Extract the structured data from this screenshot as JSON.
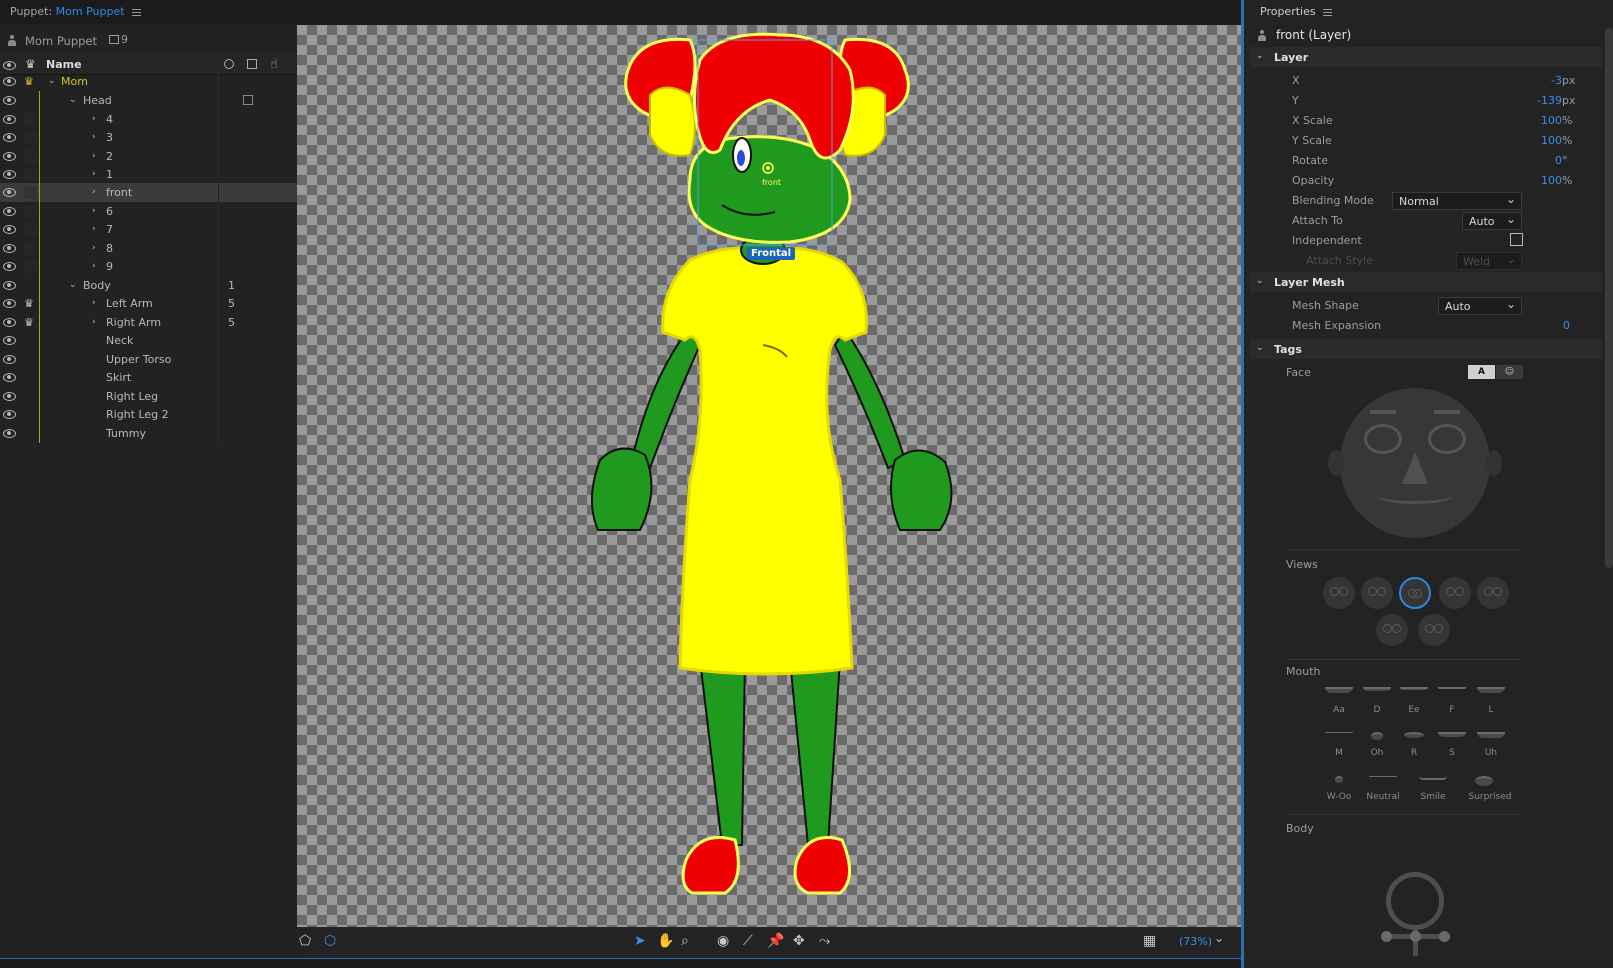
{
  "puppet_panel": {
    "tab_prefix": "Puppet: ",
    "tab_name": "Mom Puppet",
    "puppet_name": "Mom Puppet",
    "puppet_count": "9",
    "name_header": "Name",
    "rows": [
      {
        "label": "Mom",
        "count": ""
      },
      {
        "label": "Head",
        "count": ""
      },
      {
        "label": "4",
        "count": ""
      },
      {
        "label": "3",
        "count": ""
      },
      {
        "label": "2",
        "count": ""
      },
      {
        "label": "1",
        "count": ""
      },
      {
        "label": "front",
        "count": ""
      },
      {
        "label": "6",
        "count": ""
      },
      {
        "label": "7",
        "count": ""
      },
      {
        "label": "8",
        "count": ""
      },
      {
        "label": "9",
        "count": ""
      },
      {
        "label": "Body",
        "count": "1"
      },
      {
        "label": "Left Arm",
        "count": "5"
      },
      {
        "label": "Right Arm",
        "count": "5"
      },
      {
        "label": "Neck",
        "count": ""
      },
      {
        "label": "Upper Torso",
        "count": ""
      },
      {
        "label": "Skirt",
        "count": ""
      },
      {
        "label": "Right Leg",
        "count": ""
      },
      {
        "label": "Right Leg 2",
        "count": ""
      },
      {
        "label": "Tummy",
        "count": ""
      }
    ]
  },
  "stage": {
    "handle_label": "front",
    "tag_label": "Frontal",
    "zoom": "(73%)",
    "colors": {
      "hair": "#ff0000",
      "skin": "#1f9a1f",
      "dress": "#ffff00",
      "outline": "#ffff55"
    }
  },
  "properties": {
    "tab": "Properties",
    "selected": "front (Layer)",
    "layer_section": "Layer",
    "x_label": "X",
    "x_value": "-3",
    "x_unit": "px",
    "y_label": "Y",
    "y_value": "-139",
    "y_unit": "px",
    "xscale_label": "X Scale",
    "xscale_value": "100",
    "xscale_unit": "%",
    "yscale_label": "Y Scale",
    "yscale_value": "100",
    "yscale_unit": "%",
    "rotate_label": "Rotate",
    "rotate_value": "0",
    "rotate_unit": "°",
    "opacity_label": "Opacity",
    "opacity_value": "100",
    "opacity_unit": "%",
    "blending_label": "Blending Mode",
    "blending_value": "Normal",
    "attach_label": "Attach To",
    "attach_value": "Auto",
    "independent_label": "Independent",
    "attach_style_label": "Attach Style",
    "attach_style_value": "Weld",
    "mesh_section": "Layer Mesh",
    "mesh_shape_label": "Mesh Shape",
    "mesh_shape_value": "Auto",
    "mesh_expansion_label": "Mesh Expansion",
    "mesh_expansion_value": "0",
    "tags_section": "Tags",
    "face_label": "Face",
    "face_toggle_a": "A",
    "views_label": "Views",
    "mouth_label": "Mouth",
    "mouth_tags": [
      "Aa",
      "D",
      "Ee",
      "F",
      "L",
      "M",
      "Oh",
      "R",
      "S",
      "Uh",
      "W-Oo",
      "Neutral",
      "Smile",
      "Surprised"
    ],
    "body_label": "Body"
  }
}
